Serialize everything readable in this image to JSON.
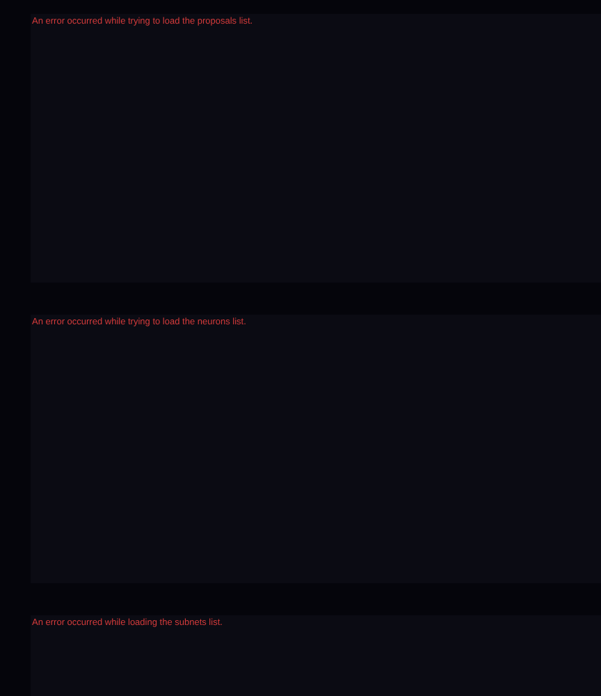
{
  "panels": [
    {
      "error": "An error occurred while trying to load the proposals list."
    },
    {
      "error": "An error occurred while trying to load the neurons list."
    },
    {
      "error": "An error occurred while loading the subnets list."
    }
  ]
}
